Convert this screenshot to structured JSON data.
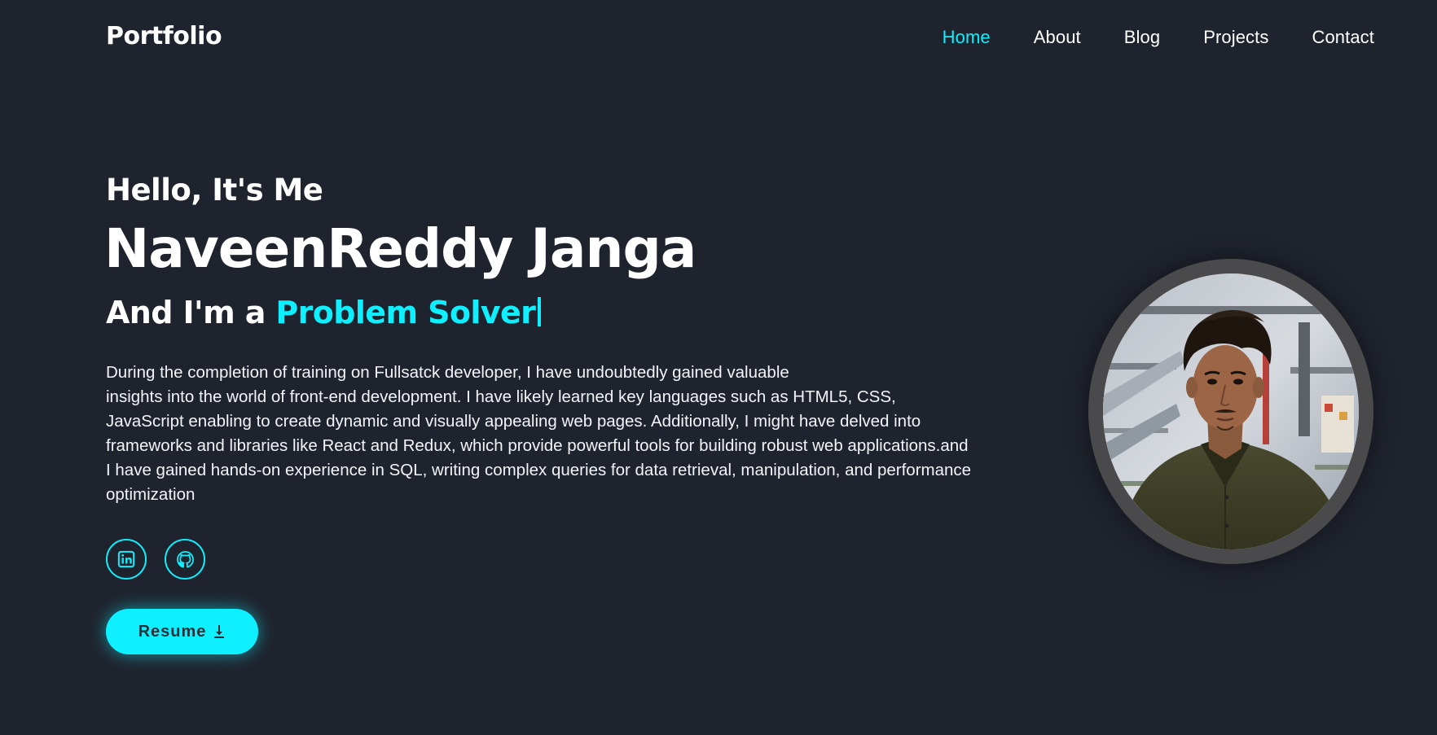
{
  "header": {
    "logo": "Portfolio",
    "nav": [
      {
        "label": "Home",
        "active": true
      },
      {
        "label": "About",
        "active": false
      },
      {
        "label": "Blog",
        "active": false
      },
      {
        "label": "Projects",
        "active": false
      },
      {
        "label": "Contact",
        "active": false
      }
    ]
  },
  "hero": {
    "greeting": "Hello, It's Me",
    "name": "NaveenReddy Janga",
    "role_prefix": "And I'm a",
    "role": "Problem Solver",
    "description_lines": [
      "During the completion of training on Fullsatck developer, I have undoubtedly gained valuable",
      "insights into the world of front-end development. I have likely learned key languages such as HTML5, CSS,",
      "JavaScript enabling to create dynamic and visually appealing web pages. Additionally, I might have delved into",
      "frameworks and libraries like React and Redux, which provide powerful tools for building robust web applications.and",
      "I have gained hands-on experience in SQL, writing complex queries for data retrieval, manipulation, and performance",
      "optimization"
    ],
    "socials": [
      {
        "icon": "linkedin-icon"
      },
      {
        "icon": "github-icon"
      }
    ],
    "resume_label": "Resume",
    "resume_icon": "download-icon"
  },
  "colors": {
    "background": "#1f232d",
    "accent": "#0ef0ff",
    "text": "#ffffff",
    "avatar_ring": "#4a4a4c"
  }
}
